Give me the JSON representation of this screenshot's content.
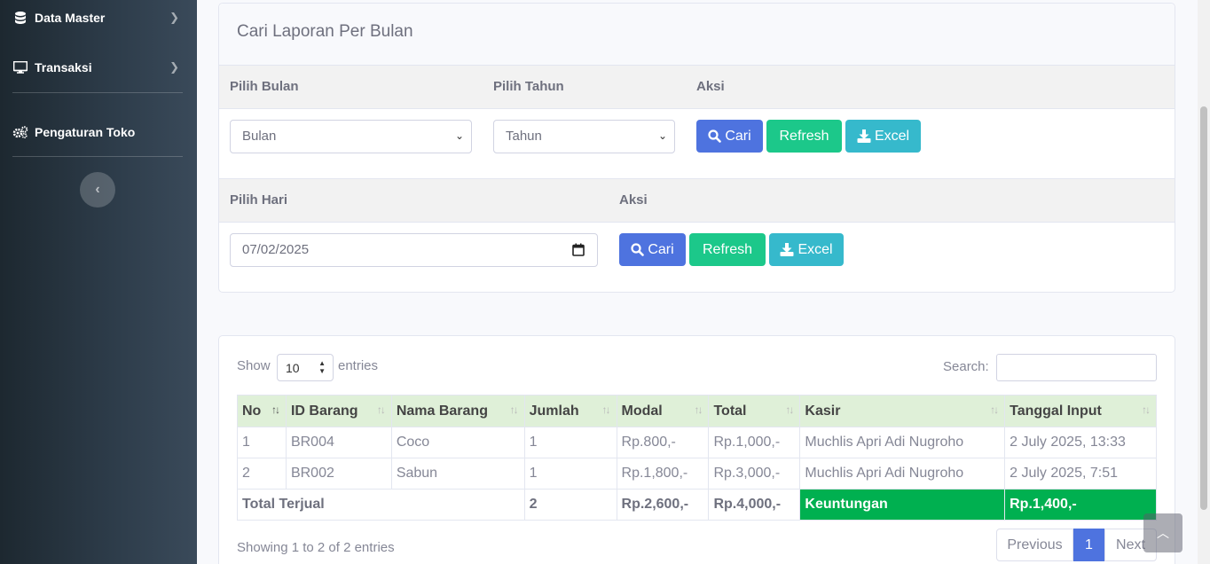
{
  "sidebar": {
    "items": [
      {
        "label": "Data Master",
        "icon": "database-icon"
      },
      {
        "label": "Transaksi",
        "icon": "desktop-icon"
      },
      {
        "label": "Pengaturan Toko",
        "icon": "cogs-icon"
      }
    ]
  },
  "monthly": {
    "title": "Cari Laporan Per Bulan",
    "label_month": "Pilih Bulan",
    "label_year": "Pilih Tahun",
    "label_action": "Aksi",
    "month_value": "Bulan",
    "year_value": "Tahun",
    "btn_search": "Cari",
    "btn_refresh": "Refresh",
    "btn_excel": "Excel"
  },
  "daily": {
    "label_day": "Pilih Hari",
    "label_action": "Aksi",
    "date_value": "07/02/2025",
    "btn_search": "Cari",
    "btn_refresh": "Refresh",
    "btn_excel": "Excel"
  },
  "datatable": {
    "show_label": "Show",
    "length_value": "10",
    "entries_label": "entries",
    "search_label": "Search:",
    "columns": [
      "No",
      "ID Barang",
      "Nama Barang",
      "Jumlah",
      "Modal",
      "Total",
      "Kasir",
      "Tanggal Input"
    ],
    "rows": [
      [
        "1",
        "BR004",
        "Coco",
        "1",
        "Rp.800,-",
        "Rp.1,000,-",
        "Muchlis Apri Adi Nugroho",
        "2 July 2025, 13:33"
      ],
      [
        "2",
        "BR002",
        "Sabun",
        "1",
        "Rp.1,800,-",
        "Rp.3,000,-",
        "Muchlis Apri Adi Nugroho",
        "2 July 2025, 7:51"
      ]
    ],
    "total": {
      "label": "Total Terjual",
      "jumlah": "2",
      "modal": "Rp.2,600,-",
      "total": "Rp.4,000,-",
      "profit_label": "Keuntungan",
      "profit_value": "Rp.1,400,-"
    },
    "info": "Showing 1 to 2 of 2 entries",
    "pagination": {
      "previous": "Previous",
      "current": "1",
      "next": "Next"
    }
  },
  "colors": {
    "primary": "#4e73df",
    "success": "#1cc88a",
    "info": "#36b9cc",
    "profit": "#00b050",
    "header": "#dff0d8"
  }
}
